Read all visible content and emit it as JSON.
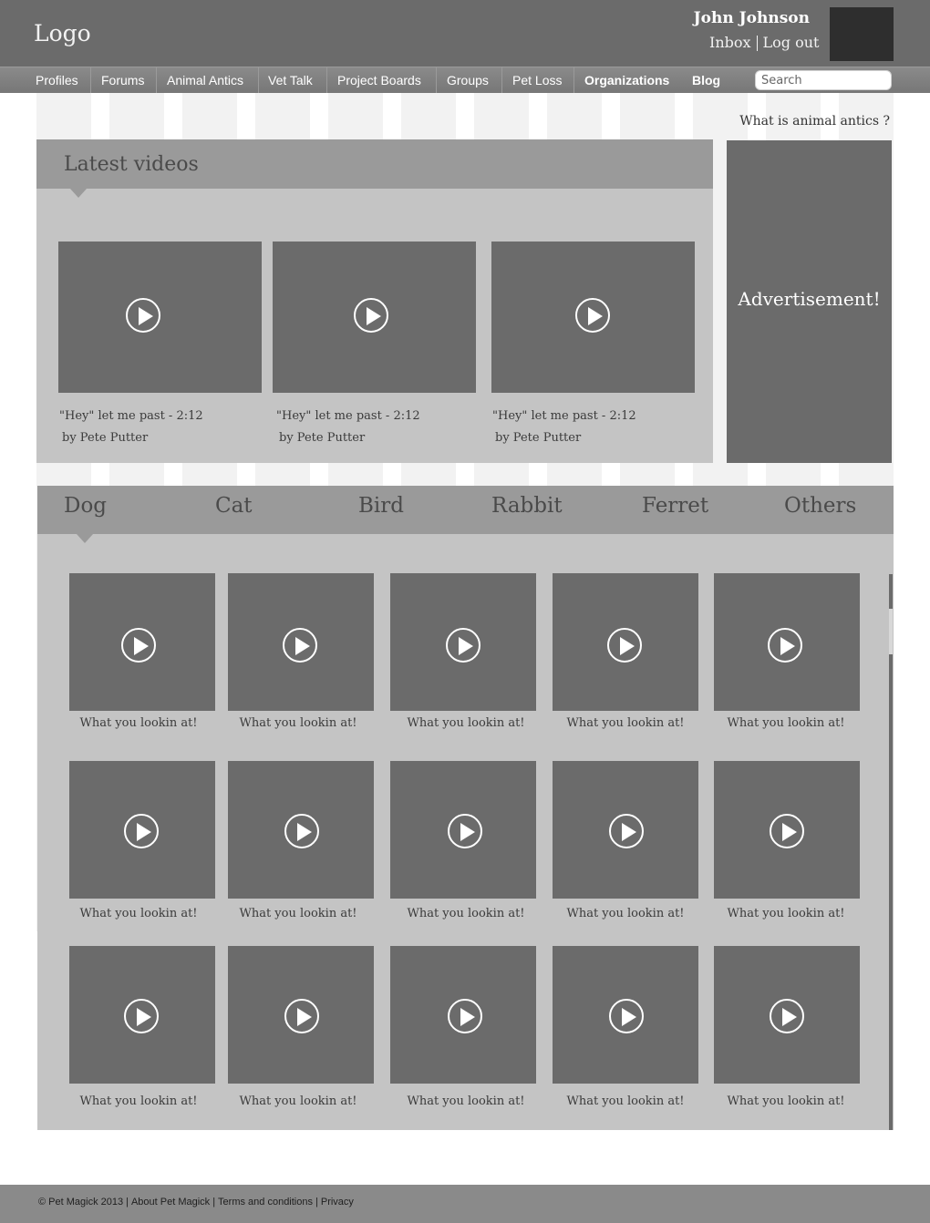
{
  "header": {
    "logo": "Logo",
    "user_name": "John Johnson",
    "inbox": "Inbox",
    "logout": "Log out"
  },
  "nav": {
    "items": [
      {
        "label": "Profiles"
      },
      {
        "label": "Forums"
      },
      {
        "label": "Animal Antics",
        "active": true
      },
      {
        "label": "Vet Talk"
      },
      {
        "label": "Project Boards"
      },
      {
        "label": "Groups"
      },
      {
        "label": "Pet Loss"
      },
      {
        "label": "Organizations"
      },
      {
        "label": "Blog"
      }
    ],
    "search_placeholder": "Search"
  },
  "info_link": "What is animal antics ?",
  "latest": {
    "title": "Latest videos",
    "videos": [
      {
        "title": "\"Hey\" let me past  -   2:12",
        "author": "by Pete Putter"
      },
      {
        "title": "\"Hey\" let me past  -   2:12",
        "author": "by Pete Putter"
      },
      {
        "title": "\"Hey\" let me past  -   2:12",
        "author": "by Pete Putter"
      }
    ]
  },
  "ad": {
    "text": "Advertisement!"
  },
  "categories": {
    "tabs": [
      "Dog",
      "Cat",
      "Bird",
      "Rabbit",
      "Ferret",
      "Others"
    ],
    "active": "Dog",
    "videos": [
      "What you lookin at!",
      "What you lookin at!",
      "What you lookin at!",
      "What you lookin at!",
      "What you lookin at!",
      "What you lookin at!",
      "What you lookin at!",
      "What you lookin at!",
      "What you lookin at!",
      "What you lookin at!",
      "What you lookin at!",
      "What you lookin at!",
      "What you lookin at!",
      "What you lookin at!",
      "What you lookin at!"
    ]
  },
  "footer": {
    "copyright": "© Pet Magick 2013",
    "about": "About Pet Magick",
    "terms": "Terms and conditions",
    "privacy": "Privacy"
  },
  "icons": {
    "play": "play-icon"
  },
  "colors": {
    "header": "#6b6b6b",
    "panel": "#c4c4c4",
    "tab_bar": "#9a9a9a",
    "thumb": "#6b6b6b",
    "footer": "#8a8a8a"
  }
}
